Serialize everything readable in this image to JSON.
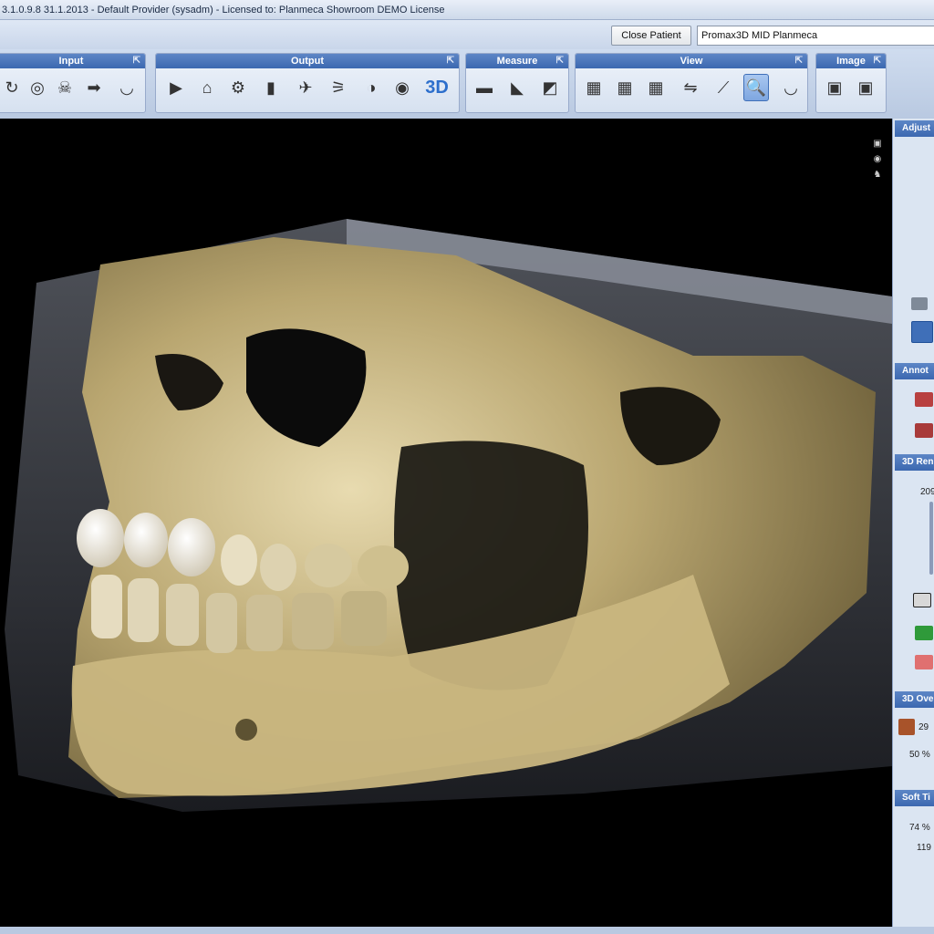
{
  "titlebar": {
    "text": "3.1.0.9.8  31.1.2013  - Default Provider (sysadm)  - Licensed to: Planmeca Showroom DEMO License"
  },
  "patient": {
    "close_label": "Close Patient",
    "name_value": "Promax3D MID Planmeca"
  },
  "toolbar": {
    "groups": [
      {
        "title": "Input",
        "pin": "⇱"
      },
      {
        "title": "Output",
        "pin": "⇱"
      },
      {
        "title": "Measure",
        "pin": "⇱"
      },
      {
        "title": "View",
        "pin": "⇱"
      },
      {
        "title": "Image",
        "pin": "⇱"
      }
    ],
    "three_d_label": "3D"
  },
  "icons": {
    "input": [
      "rotate-icon",
      "tooth-icon",
      "skull-icon",
      "import-icon",
      "arch-icon"
    ],
    "output": [
      "export-icon",
      "print-icon",
      "network-icon",
      "save-icon",
      "send-icon",
      "pano-icon",
      "settings-icon",
      "eye-icon",
      "3d-icon"
    ],
    "measure": [
      "distance-icon",
      "angle-icon",
      "area-icon"
    ],
    "view": [
      "layout-icon",
      "layout-icon",
      "layout-icon",
      "flip-icon",
      "slice-icon",
      "zoom-icon",
      "arch-icon"
    ],
    "image": [
      "image-icon",
      "image-icon"
    ]
  },
  "right_panel": {
    "adjust_title": "Adjust",
    "annotation_title": "Annot",
    "render_title": "3D Ren",
    "render_value": "209",
    "overlay_title": "3D Ove",
    "overlay_pct": "29",
    "overlay_percent_label": "50 %",
    "softtissue_title": "Soft Ti",
    "softtissue_pct": "74 %",
    "softtissue_value": "119"
  },
  "colors": {
    "accent": "#3c68b0",
    "bone": "#cdbb8a",
    "background": "#000000"
  }
}
